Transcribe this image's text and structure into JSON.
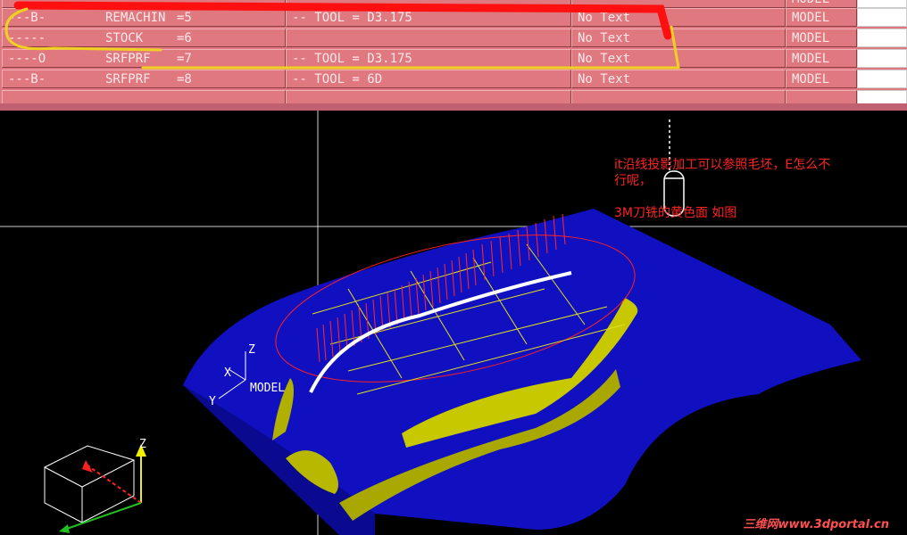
{
  "operations": {
    "rows": [
      {
        "name": "---B-",
        "type": "REMACHIN",
        "index": "=5",
        "tool": "-- TOOL = D3.175",
        "text": "No Text",
        "mode": "MODEL"
      },
      {
        "name": "-----",
        "type": "STOCK",
        "index": "=6",
        "tool": "",
        "text": "No Text",
        "mode": "MODEL"
      },
      {
        "name": "----O",
        "type": "SRFPRF",
        "index": "=7",
        "tool": "-- TOOL = D3.175",
        "text": "No Text",
        "mode": "MODEL"
      },
      {
        "name": "---B-",
        "type": "SRFPRF",
        "index": "=8",
        "tool": "-- TOOL = 6D",
        "text": "No Text",
        "mode": "MODEL"
      }
    ],
    "header_text": "MODEL"
  },
  "annotations": {
    "line1": "it沿线投影加工可以参照毛坯，E怎么不",
    "line2": "行呢，",
    "line3": "3M刀铣的黄色面 如图"
  },
  "viewport": {
    "axis_label": "MODEL",
    "axis_x": "X",
    "axis_y": "Y",
    "axis_z": "Z",
    "cube_axis_z": "Z"
  },
  "watermark": "三维网www.3dportal.cn",
  "colors": {
    "panel": "#e07880",
    "surface": "#1010c0",
    "highlight": "#c8c800",
    "annotation": "#ff2222"
  }
}
